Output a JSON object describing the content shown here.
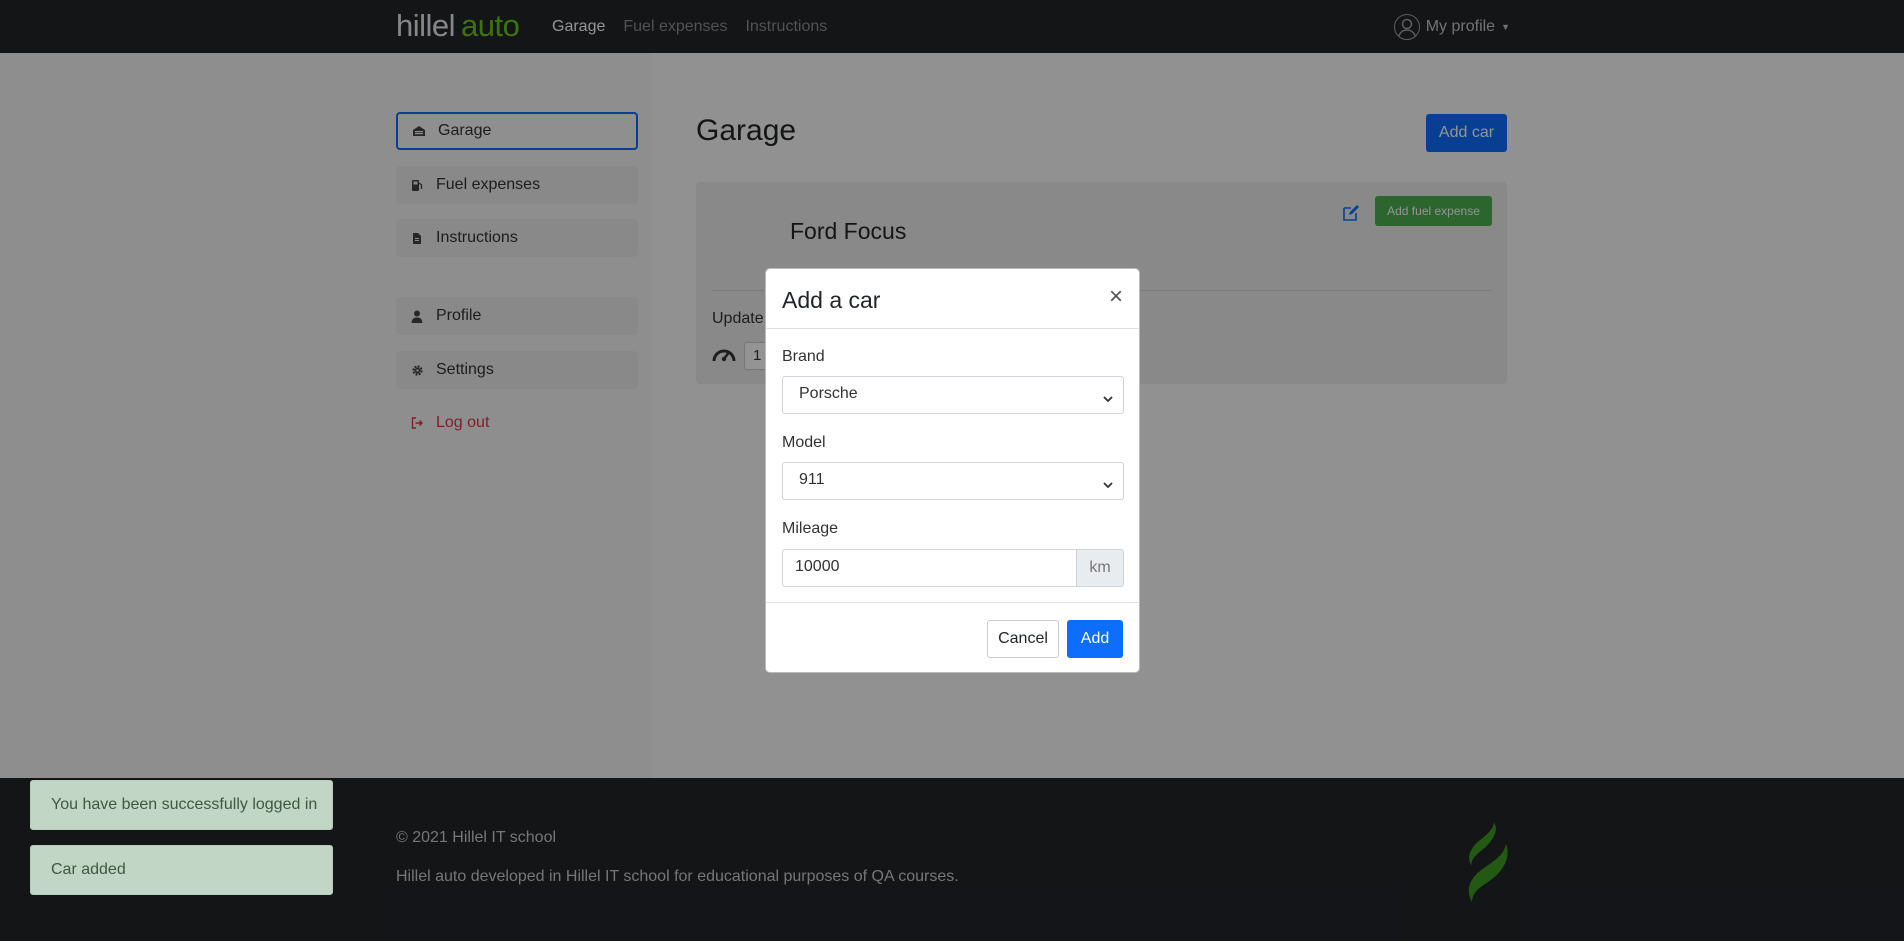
{
  "navbar": {
    "logo_main": "hillel",
    "logo_accent": "auto",
    "links": [
      {
        "label": "Garage",
        "active": true
      },
      {
        "label": "Fuel expenses",
        "active": false
      },
      {
        "label": "Instructions",
        "active": false
      }
    ],
    "profile_label": "My profile"
  },
  "sidebar": {
    "items": [
      {
        "label": "Garage",
        "icon": "garage-icon"
      },
      {
        "label": "Fuel expenses",
        "icon": "fuel-icon"
      },
      {
        "label": "Instructions",
        "icon": "document-icon"
      },
      {
        "label": "Profile",
        "icon": "person-icon"
      },
      {
        "label": "Settings",
        "icon": "gear-icon"
      },
      {
        "label": "Log out",
        "icon": "logout-icon"
      }
    ]
  },
  "main": {
    "title": "Garage",
    "add_car_label": "Add car",
    "car": {
      "name": "Ford Focus",
      "add_fuel_label": "Add fuel expense",
      "update_text": "Update",
      "mileage_partial": "1"
    }
  },
  "modal": {
    "title": "Add a car",
    "close_glyph": "×",
    "brand": {
      "label": "Brand",
      "value": "Porsche"
    },
    "model": {
      "label": "Model",
      "value": "911"
    },
    "mileage": {
      "label": "Mileage",
      "value": "10000",
      "unit": "km"
    },
    "cancel_label": "Cancel",
    "add_label": "Add"
  },
  "toasts": [
    "You have been successfully logged in",
    "Car added"
  ],
  "footer": {
    "copyright": "© 2021 Hillel IT school",
    "description": "Hillel auto developed in Hillel IT school for educational purposes of QA courses."
  },
  "colors": {
    "primary": "#0d6efd",
    "success": "#4caf50",
    "danger": "#dc3545",
    "navbar": "#212529",
    "logo_accent": "#6bc51c"
  }
}
